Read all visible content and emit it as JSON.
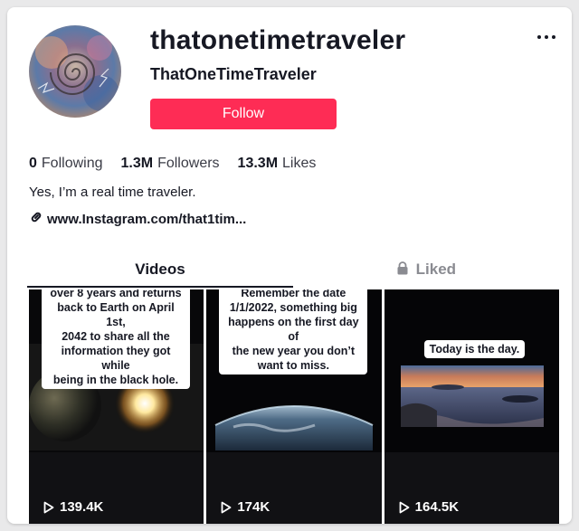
{
  "profile": {
    "username": "thatonetimetraveler",
    "display_name": "ThatOneTimeTraveler",
    "follow_label": "Follow",
    "bio": "Yes, I’m a real time traveler.",
    "link": "www.Instagram.com/that1tim...",
    "avatar_icon": "spiral-clock-avatar"
  },
  "stats": [
    {
      "value": "0",
      "label": "Following"
    },
    {
      "value": "1.3M",
      "label": "Followers"
    },
    {
      "value": "13.3M",
      "label": "Likes"
    }
  ],
  "tabs": [
    {
      "label": "Videos",
      "active": true
    },
    {
      "label": "Liked",
      "active": false,
      "icon": "lock-icon"
    }
  ],
  "videos": [
    {
      "caption": [
        "over 8 years and returns",
        "back to Earth on April 1st,",
        "2042 to share all the",
        "information they got while",
        "being in the black hole."
      ],
      "views": "139.4K"
    },
    {
      "caption": [
        "Remember the date",
        "1/1/2022, something big",
        "happens on the first day of",
        "the new year you don’t",
        "want to miss."
      ],
      "views": "174K"
    },
    {
      "caption": [
        "Today is the day."
      ],
      "views": "164.5K"
    }
  ],
  "colors": {
    "accent": "#fe2c55",
    "text": "#161823",
    "muted": "#8a8b91"
  }
}
